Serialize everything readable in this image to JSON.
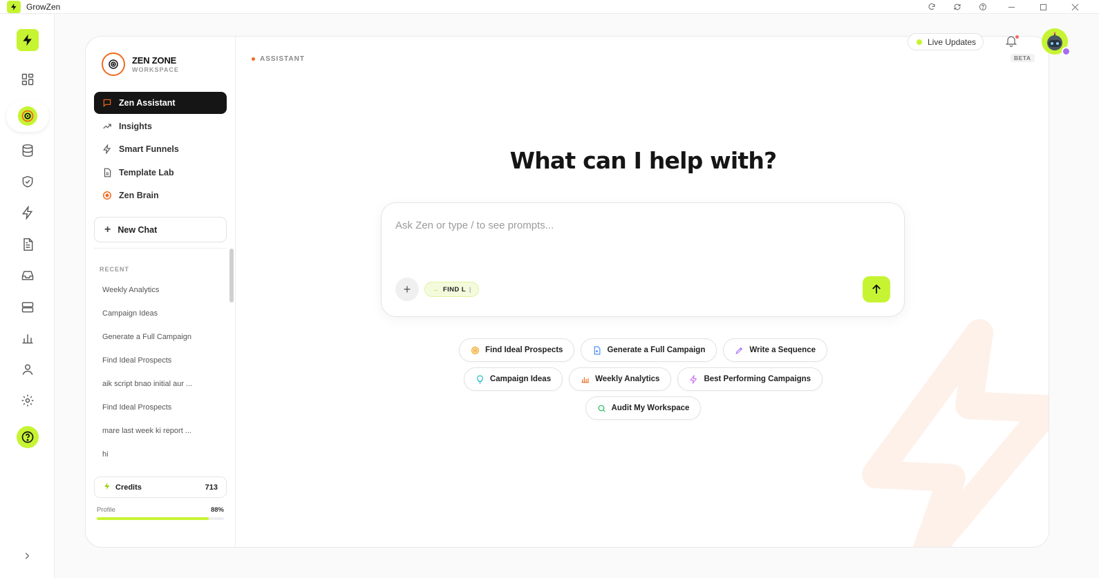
{
  "window": {
    "title": "GrowZen",
    "controls": [
      "refresh-icon",
      "sync-icon",
      "help-icon",
      "minimize-icon",
      "maximize-icon",
      "close-icon"
    ]
  },
  "colors": {
    "accent": "#c6f432",
    "brand_orange": "#f06a1e",
    "dark": "#151515"
  },
  "rail": {
    "items": [
      "dashboard-icon",
      "target-icon",
      "database-icon",
      "shield-icon",
      "bolt-icon",
      "document-icon",
      "inbox-icon",
      "server-icon",
      "bar-chart-icon",
      "user-icon",
      "gear-icon",
      "help-icon",
      "chevron-right-icon"
    ]
  },
  "workspace": {
    "name": "ZEN ZONE",
    "subtitle": "WORKSPACE"
  },
  "nav": {
    "items": [
      {
        "label": "Zen Assistant",
        "icon": "chat-icon",
        "active": true
      },
      {
        "label": "Insights",
        "icon": "trend-icon"
      },
      {
        "label": "Smart Funnels",
        "icon": "bolt-icon"
      },
      {
        "label": "Template Lab",
        "icon": "document-icon"
      },
      {
        "label": "Zen Brain",
        "icon": "target-icon"
      }
    ],
    "new_chat": "New Chat"
  },
  "recent": {
    "label": "RECENT",
    "items": [
      "Weekly Analytics",
      "Campaign Ideas",
      "Generate a Full Campaign",
      "Find Ideal Prospects",
      "aik script bnao initial aur ...",
      "Find Ideal Prospects",
      "mare last week ki report ...",
      "hi"
    ]
  },
  "credits": {
    "label": "Credits",
    "value": "713"
  },
  "profile": {
    "label": "Profile",
    "percent_text": "88%",
    "percent": 88
  },
  "main": {
    "breadcrumb": "ASSISTANT",
    "heading": "What can I help with?",
    "composer": {
      "placeholder": "Ask Zen or type / to see prompts...",
      "tag": "FIND L",
      "tag_caret": "|"
    },
    "suggestions": [
      [
        {
          "label": "Find Ideal Prospects",
          "icon": "target-icon",
          "color": "#f0a51e"
        },
        {
          "label": "Generate a Full Campaign",
          "icon": "document-plus-icon",
          "color": "#3b82f6"
        },
        {
          "label": "Write a Sequence",
          "icon": "pen-icon",
          "color": "#a56cf0"
        }
      ],
      [
        {
          "label": "Campaign Ideas",
          "icon": "lightbulb-icon",
          "color": "#14b8c8"
        },
        {
          "label": "Weekly Analytics",
          "icon": "bar-chart-icon",
          "color": "#f06a1e"
        },
        {
          "label": "Best Performing Campaigns",
          "icon": "bolt-icon",
          "color": "#c86cf0"
        }
      ],
      [
        {
          "label": "Audit My Workspace",
          "icon": "search-icon",
          "color": "#22b85a"
        }
      ]
    ]
  },
  "topbar": {
    "live_updates": "Live Updates",
    "beta": "BETA"
  }
}
